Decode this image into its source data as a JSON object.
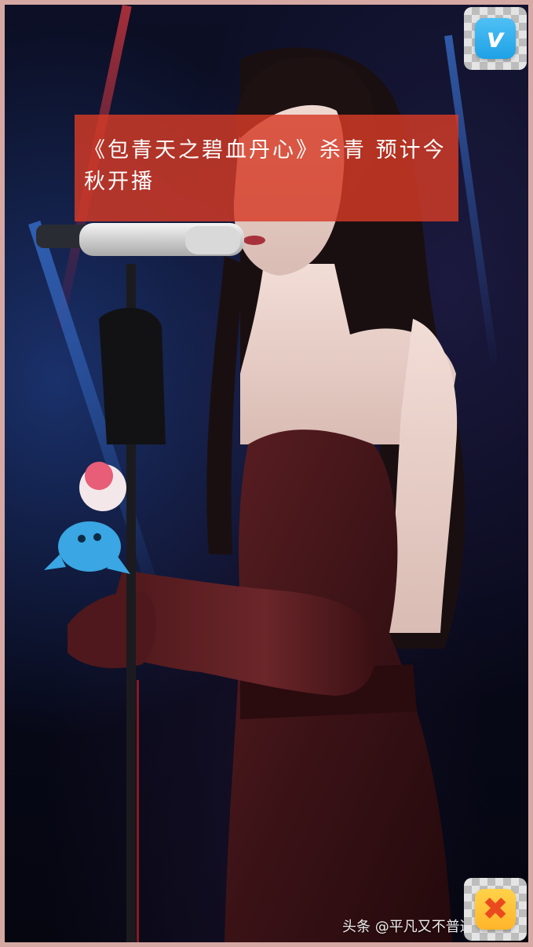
{
  "headline": {
    "text": "《包青天之碧血丹心》杀青 预计今秋开播"
  },
  "watermark": {
    "text": "头条 @平凡又不普通的"
  },
  "buttons": {
    "vimeo_icon": "vimeo-icon",
    "vimeo_glyph": "v",
    "close_icon": "close-icon",
    "close_glyph": "✖"
  },
  "colors": {
    "headline_bg": "#d63a26",
    "frame_border": "#d6a8a4",
    "vimeo_blue": "#1ea1e6",
    "close_yellow": "#ffb52b"
  }
}
